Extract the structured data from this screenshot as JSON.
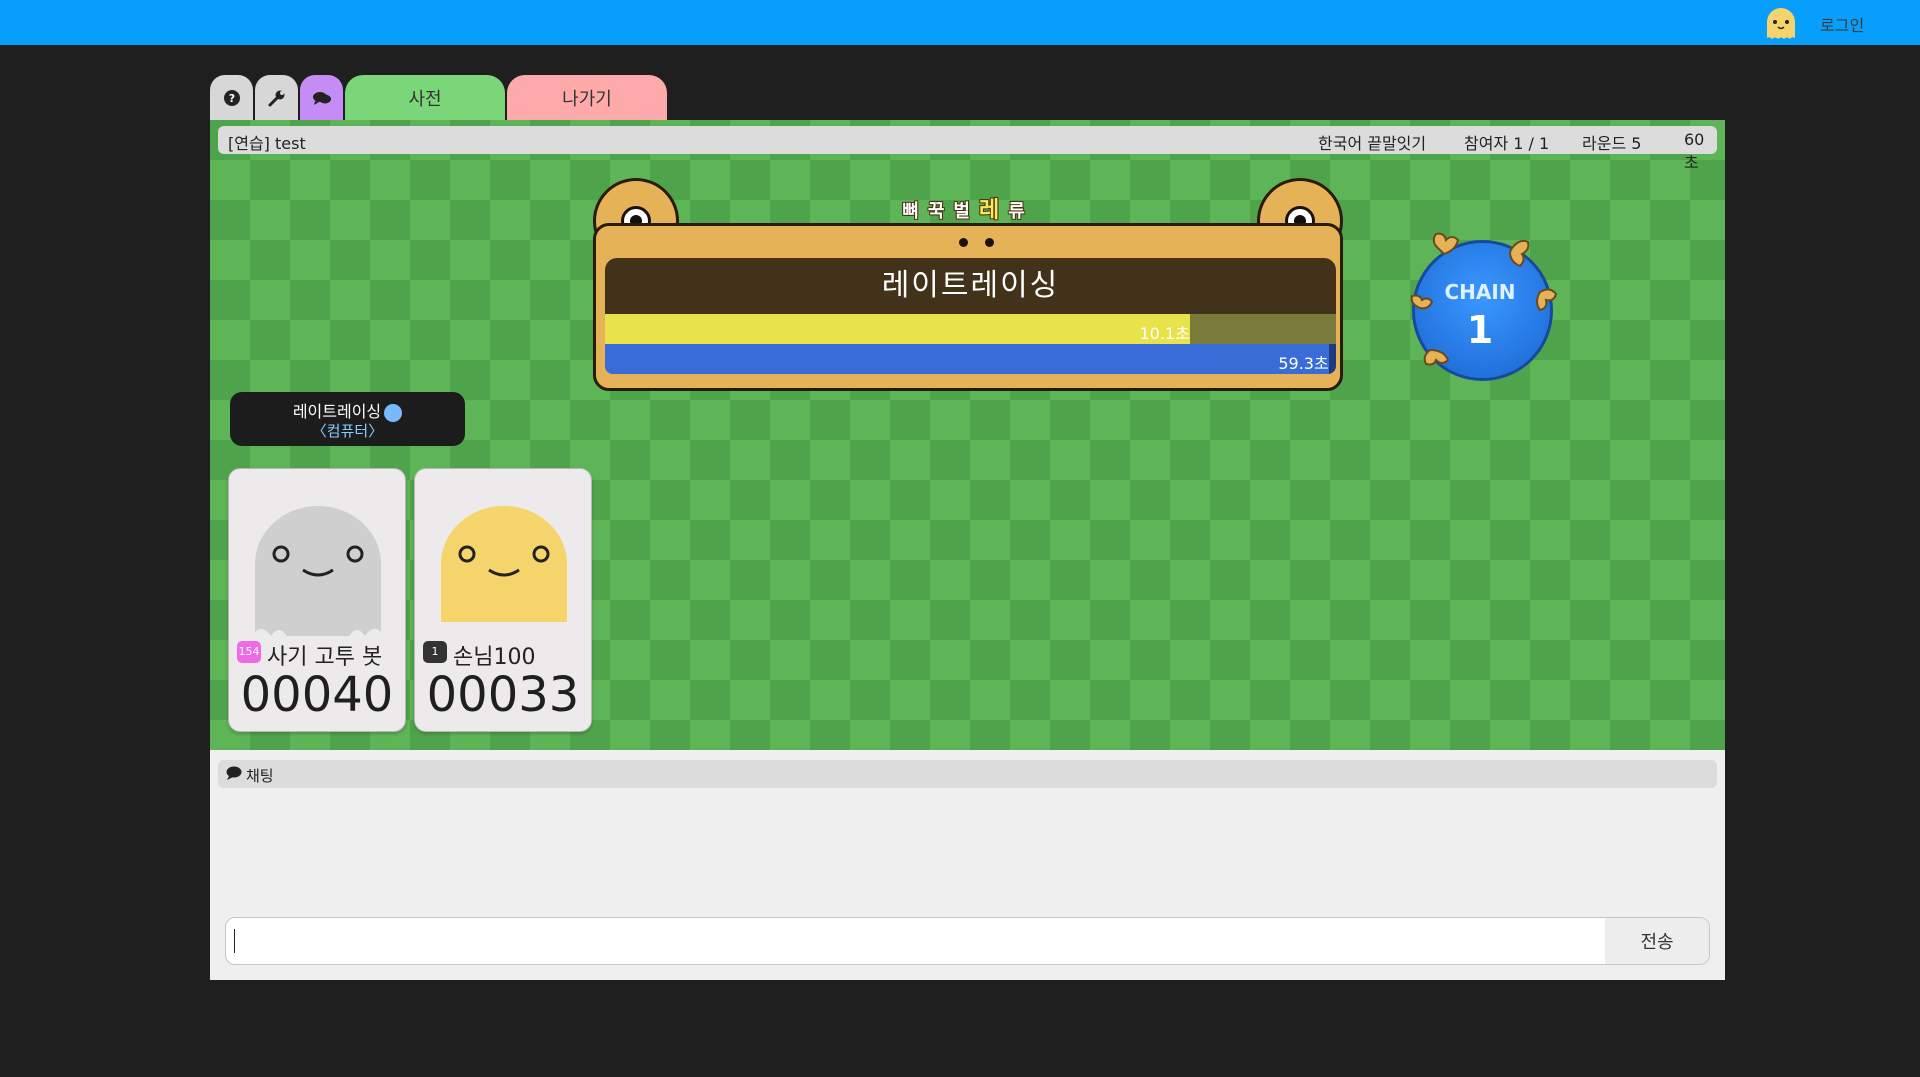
{
  "topbar": {
    "login_label": "로그인",
    "avatar_icon": "ghost-avatar-icon"
  },
  "tabs": {
    "help_icon": "question-circle-icon",
    "settings_icon": "wrench-icon",
    "chat_icon": "chat-bubble-icon",
    "dictionary_label": "사전",
    "exit_label": "나가기"
  },
  "room": {
    "title_prefix": "[연습]",
    "title": "test",
    "mode": "한국어 끝말잇기",
    "participants": "참여자 1 / 1",
    "round": "라운드 5",
    "time": "60초"
  },
  "board": {
    "hint_chars": [
      "뼈",
      "꾹",
      "벌"
    ],
    "hint_current": "레",
    "hint_after": "류",
    "current_word": "레이트레이싱",
    "turn_time": "10.1초",
    "turn_fill": 0.8,
    "round_time": "59.3초",
    "round_fill": 0.99
  },
  "chain": {
    "label": "CHAIN",
    "count": "1"
  },
  "current_player": {
    "word": "레이트레이싱",
    "role": "〈컴퓨터〉"
  },
  "players": [
    {
      "level": "154",
      "name": "사기 고투 봇",
      "score": "00040",
      "color": "#cfcfcf"
    },
    {
      "level": "1",
      "name": "손님100",
      "score": "00033",
      "color": "#f4d46b"
    }
  ],
  "chat": {
    "label": "채팅",
    "send_label": "전송",
    "input_value": ""
  },
  "colors": {
    "topbar": "#079ffb",
    "game_bg": "#57ad52",
    "dictionary_tab": "#7bd67a",
    "exit_tab": "#ffaaaa"
  }
}
